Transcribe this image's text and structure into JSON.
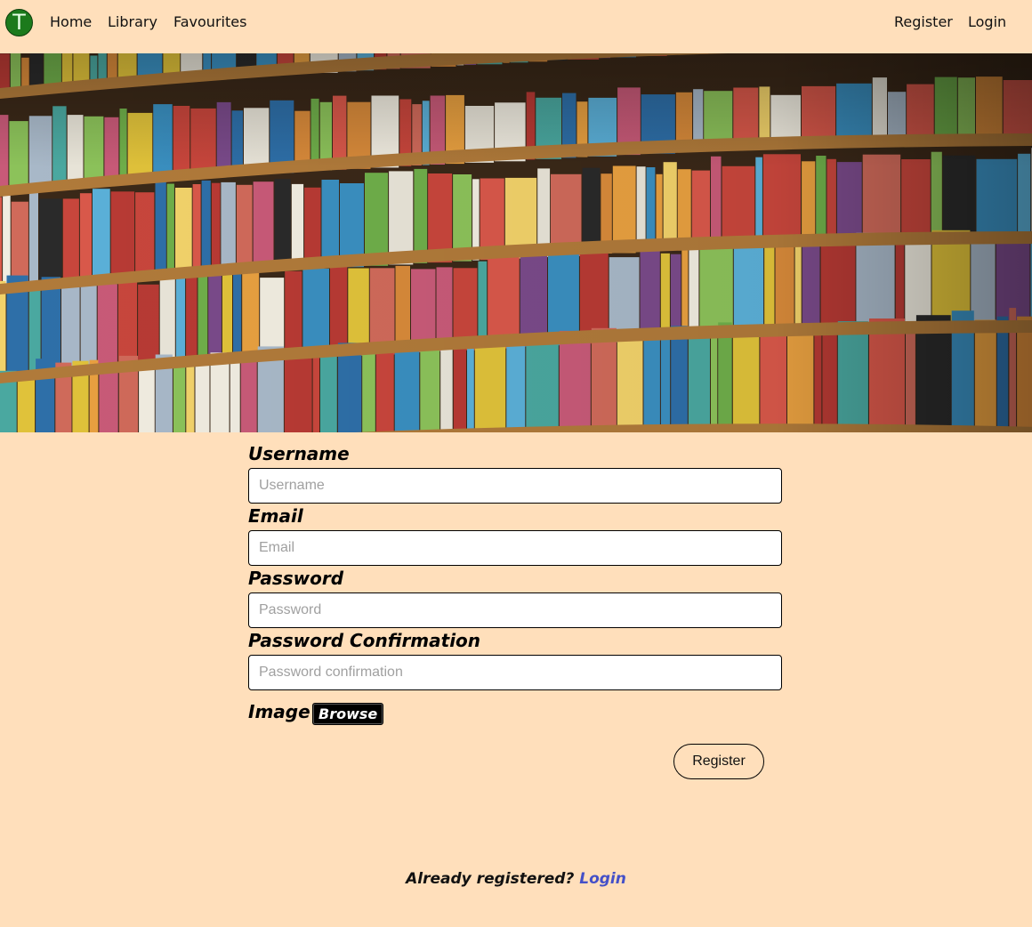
{
  "navbar": {
    "logo_letter": "T",
    "links": {
      "home": "Home",
      "library": "Library",
      "favourites": "Favourites",
      "register": "Register",
      "login": "Login"
    }
  },
  "form": {
    "username": {
      "label": "Username",
      "placeholder": "Username"
    },
    "email": {
      "label": "Email",
      "placeholder": "Email"
    },
    "password": {
      "label": "Password",
      "placeholder": "Password"
    },
    "password_confirmation": {
      "label": "Password Confirmation",
      "placeholder": "Password confirmation"
    },
    "image": {
      "label": "Image",
      "browse_label": "Browse"
    },
    "submit_label": "Register"
  },
  "footer": {
    "prompt": "Already registered?",
    "login_link": "Login"
  },
  "colors": {
    "background": "#ffdfbb",
    "logo": "#1c7a1c",
    "link_accent": "#4450c8"
  }
}
